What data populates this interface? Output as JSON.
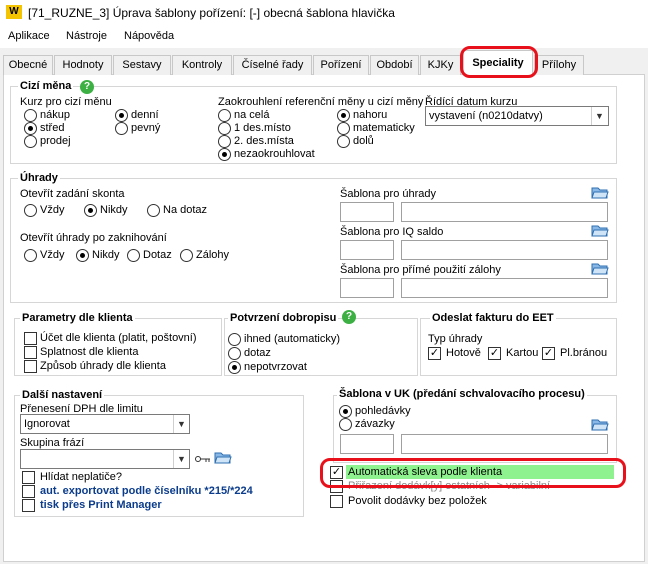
{
  "window": {
    "title": "[71_RUZNE_3] Úprava šablony pořízení: [-] obecná šablona hlavička",
    "app_icon": "W"
  },
  "menu": [
    "Aplikace",
    "Nástroje",
    "Nápověda"
  ],
  "tabs": [
    "Obecné",
    "Hodnoty",
    "Sestavy",
    "Kontroly",
    "Číselné řady",
    "Pořízení",
    "Období",
    "KJKy",
    "Speciality",
    "Přílohy"
  ],
  "active_tab": "Speciality",
  "cizi_mena": {
    "title": "Cizí měna",
    "kurz_label": "Kurz pro cizí měnu",
    "kurz_options": [
      "nákup",
      "střed",
      "prodej",
      "denní",
      "pevný"
    ],
    "zaokr_label": "Zaokrouhlení referenční měny u cizí měny",
    "zaokr_options": [
      "na celá",
      "1 des.místo",
      "2. des.místa",
      "nezaokrouhlovat"
    ],
    "smer_options": [
      "nahoru",
      "matematicky",
      "dolů"
    ],
    "ridici_label": "Řídící datum kurzu",
    "ridici_value": "vystavení (n0210datvy)"
  },
  "uhrady": {
    "title": "Úhrady",
    "skonto_label": "Otevřít zadání skonta",
    "skonto_options": [
      "Vždy",
      "Nikdy",
      "Na dotaz"
    ],
    "zakn_label": "Otevřít úhrady po zaknihování",
    "zakn_options": [
      "Vždy",
      "Nikdy",
      "Dotaz",
      "Zálohy"
    ],
    "sablona_uhrady": "Šablona pro úhrady",
    "sablona_iq": "Šablona pro IQ saldo",
    "sablona_zalohy": "Šablona pro přímé použití zálohy"
  },
  "parametry": {
    "title": "Parametry dle klienta",
    "items": [
      "Účet dle klienta (platit, poštovní)",
      "Splatnost dle klienta",
      "Způsob úhrady dle klienta"
    ]
  },
  "dobropis": {
    "title": "Potvrzení dobropisu",
    "options": [
      "ihned (automaticky)",
      "dotaz",
      "nepotvrzovat"
    ]
  },
  "eet": {
    "title": "Odeslat fakturu do EET",
    "typ_label": "Typ úhrady",
    "items": [
      "Hotově",
      "Kartou",
      "Pl.bránou"
    ]
  },
  "dalsi": {
    "title": "Další nastavení",
    "dph_label": "Přenesení DPH dle limitu",
    "dph_value": "Ignorovat",
    "fraze_label": "Skupina frází",
    "fraze_value": "",
    "hlidat": "Hlídat neplatiče?",
    "export_link": "aut. exportovat podle číselníku *215/*224",
    "tisk_link": "tisk přes Print Manager"
  },
  "uk": {
    "title": "Šablona v UK (předání schvalovacího procesu)",
    "options": [
      "pohledávky",
      "závazky"
    ]
  },
  "extra": {
    "sleva": "Automatická sleva podle klienta",
    "prirazeni": "Přiřazení dodávk[y] ostatních -> variabilní",
    "povolit": "Povolit dodávky bez položek"
  }
}
